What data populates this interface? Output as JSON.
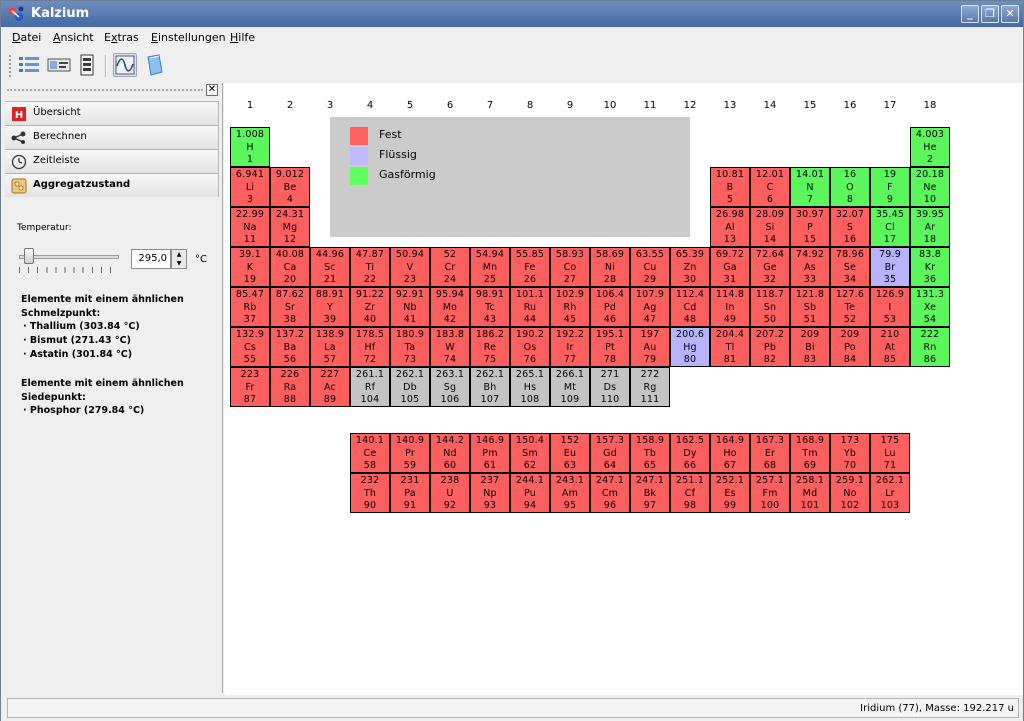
{
  "window": {
    "title": "Kalzium"
  },
  "menu": [
    "Datei",
    "Ansicht",
    "Extras",
    "Einstellungen",
    "Hilfe"
  ],
  "menu_underline": [
    "D",
    "A",
    "x",
    "E",
    "H"
  ],
  "sidebar": {
    "tabs": [
      "Übersicht",
      "Berechnen",
      "Zeitleiste",
      "Aggregatzustand"
    ],
    "temperature_label": "Temperatur:",
    "temperature_value": "295,0",
    "temperature_unit": "°C",
    "slider_level_fraction": 0.05,
    "melting_heading": "Elemente mit einem ähnlichen Schmelzpunkt:",
    "melting": [
      "· Thallium (303.84 °C)",
      "· Bismut (271.43 °C)",
      "· Astatin (301.84 °C)"
    ],
    "boiling_heading": "Elemente mit einem ähnlichen Siedepunkt:",
    "boiling": [
      "· Phosphor (279.84 °C)"
    ]
  },
  "groups": [
    "1",
    "2",
    "3",
    "4",
    "5",
    "6",
    "7",
    "8",
    "9",
    "10",
    "11",
    "12",
    "13",
    "14",
    "15",
    "16",
    "17",
    "18"
  ],
  "legend": [
    {
      "label": "Fest",
      "color": "#ff6060"
    },
    {
      "label": "Flüssig",
      "color": "#bfb8ff"
    },
    {
      "label": "Gasförmig",
      "color": "#60ff60"
    }
  ],
  "state_colors": {
    "s": "#ff5f5f",
    "l": "#b9b2ff",
    "g": "#5cf75c",
    "u": "#c4c4c4"
  },
  "elements": [
    [
      "1.008",
      "H",
      "1",
      1,
      1,
      "g"
    ],
    [
      "4.003",
      "He",
      "2",
      18,
      1,
      "g"
    ],
    [
      "6.941",
      "Li",
      "3",
      1,
      2,
      "s"
    ],
    [
      "9.012",
      "Be",
      "4",
      2,
      2,
      "s"
    ],
    [
      "10.81",
      "B",
      "5",
      13,
      2,
      "s"
    ],
    [
      "12.01",
      "C",
      "6",
      14,
      2,
      "s"
    ],
    [
      "14.01",
      "N",
      "7",
      15,
      2,
      "g"
    ],
    [
      "16",
      "O",
      "8",
      16,
      2,
      "g"
    ],
    [
      "19",
      "F",
      "9",
      17,
      2,
      "g"
    ],
    [
      "20.18",
      "Ne",
      "10",
      18,
      2,
      "g"
    ],
    [
      "22.99",
      "Na",
      "11",
      1,
      3,
      "s"
    ],
    [
      "24.31",
      "Mg",
      "12",
      2,
      3,
      "s"
    ],
    [
      "26.98",
      "Al",
      "13",
      13,
      3,
      "s"
    ],
    [
      "28.09",
      "Si",
      "14",
      14,
      3,
      "s"
    ],
    [
      "30.97",
      "P",
      "15",
      15,
      3,
      "s"
    ],
    [
      "32.07",
      "S",
      "16",
      16,
      3,
      "s"
    ],
    [
      "35.45",
      "Cl",
      "17",
      17,
      3,
      "g"
    ],
    [
      "39.95",
      "Ar",
      "18",
      18,
      3,
      "g"
    ],
    [
      "39.1",
      "K",
      "19",
      1,
      4,
      "s"
    ],
    [
      "40.08",
      "Ca",
      "20",
      2,
      4,
      "s"
    ],
    [
      "44.96",
      "Sc",
      "21",
      3,
      4,
      "s"
    ],
    [
      "47.87",
      "Ti",
      "22",
      4,
      4,
      "s"
    ],
    [
      "50.94",
      "V",
      "23",
      5,
      4,
      "s"
    ],
    [
      "52",
      "Cr",
      "24",
      6,
      4,
      "s"
    ],
    [
      "54.94",
      "Mn",
      "25",
      7,
      4,
      "s"
    ],
    [
      "55.85",
      "Fe",
      "26",
      8,
      4,
      "s"
    ],
    [
      "58.93",
      "Co",
      "27",
      9,
      4,
      "s"
    ],
    [
      "58.69",
      "Ni",
      "28",
      10,
      4,
      "s"
    ],
    [
      "63.55",
      "Cu",
      "29",
      11,
      4,
      "s"
    ],
    [
      "65.39",
      "Zn",
      "30",
      12,
      4,
      "s"
    ],
    [
      "69.72",
      "Ga",
      "31",
      13,
      4,
      "s"
    ],
    [
      "72.64",
      "Ge",
      "32",
      14,
      4,
      "s"
    ],
    [
      "74.92",
      "As",
      "33",
      15,
      4,
      "s"
    ],
    [
      "78.96",
      "Se",
      "34",
      16,
      4,
      "s"
    ],
    [
      "79.9",
      "Br",
      "35",
      17,
      4,
      "l"
    ],
    [
      "83.8",
      "Kr",
      "36",
      18,
      4,
      "g"
    ],
    [
      "85.47",
      "Rb",
      "37",
      1,
      5,
      "s"
    ],
    [
      "87.62",
      "Sr",
      "38",
      2,
      5,
      "s"
    ],
    [
      "88.91",
      "Y",
      "39",
      3,
      5,
      "s"
    ],
    [
      "91.22",
      "Zr",
      "40",
      4,
      5,
      "s"
    ],
    [
      "92.91",
      "Nb",
      "41",
      5,
      5,
      "s"
    ],
    [
      "95.94",
      "Mo",
      "42",
      6,
      5,
      "s"
    ],
    [
      "98.91",
      "Tc",
      "43",
      7,
      5,
      "s"
    ],
    [
      "101.1",
      "Ru",
      "44",
      8,
      5,
      "s"
    ],
    [
      "102.9",
      "Rh",
      "45",
      9,
      5,
      "s"
    ],
    [
      "106.4",
      "Pd",
      "46",
      10,
      5,
      "s"
    ],
    [
      "107.9",
      "Ag",
      "47",
      11,
      5,
      "s"
    ],
    [
      "112.4",
      "Cd",
      "48",
      12,
      5,
      "s"
    ],
    [
      "114.8",
      "In",
      "49",
      13,
      5,
      "s"
    ],
    [
      "118.7",
      "Sn",
      "50",
      14,
      5,
      "s"
    ],
    [
      "121.8",
      "Sb",
      "51",
      15,
      5,
      "s"
    ],
    [
      "127.6",
      "Te",
      "52",
      16,
      5,
      "s"
    ],
    [
      "126.9",
      "I",
      "53",
      17,
      5,
      "s"
    ],
    [
      "131.3",
      "Xe",
      "54",
      18,
      5,
      "g"
    ],
    [
      "132.9",
      "Cs",
      "55",
      1,
      6,
      "s"
    ],
    [
      "137.2",
      "Ba",
      "56",
      2,
      6,
      "s"
    ],
    [
      "138.9",
      "La",
      "57",
      3,
      6,
      "s"
    ],
    [
      "178.5",
      "Hf",
      "72",
      4,
      6,
      "s"
    ],
    [
      "180.9",
      "Ta",
      "73",
      5,
      6,
      "s"
    ],
    [
      "183.8",
      "W",
      "74",
      6,
      6,
      "s"
    ],
    [
      "186.2",
      "Re",
      "75",
      7,
      6,
      "s"
    ],
    [
      "190.2",
      "Os",
      "76",
      8,
      6,
      "s"
    ],
    [
      "192.2",
      "Ir",
      "77",
      9,
      6,
      "s"
    ],
    [
      "195.1",
      "Pt",
      "78",
      10,
      6,
      "s"
    ],
    [
      "197",
      "Au",
      "79",
      11,
      6,
      "s"
    ],
    [
      "200.6",
      "Hg",
      "80",
      12,
      6,
      "l"
    ],
    [
      "204.4",
      "Tl",
      "81",
      13,
      6,
      "s"
    ],
    [
      "207.2",
      "Pb",
      "82",
      14,
      6,
      "s"
    ],
    [
      "209",
      "Bi",
      "83",
      15,
      6,
      "s"
    ],
    [
      "209",
      "Po",
      "84",
      16,
      6,
      "s"
    ],
    [
      "210",
      "At",
      "85",
      17,
      6,
      "s"
    ],
    [
      "222",
      "Rn",
      "86",
      18,
      6,
      "g"
    ],
    [
      "223",
      "Fr",
      "87",
      1,
      7,
      "s"
    ],
    [
      "226",
      "Ra",
      "88",
      2,
      7,
      "s"
    ],
    [
      "227",
      "Ac",
      "89",
      3,
      7,
      "s"
    ],
    [
      "261.1",
      "Rf",
      "104",
      4,
      7,
      "u"
    ],
    [
      "262.1",
      "Db",
      "105",
      5,
      7,
      "u"
    ],
    [
      "263.1",
      "Sg",
      "106",
      6,
      7,
      "u"
    ],
    [
      "262.1",
      "Bh",
      "107",
      7,
      7,
      "u"
    ],
    [
      "265.1",
      "Hs",
      "108",
      8,
      7,
      "u"
    ],
    [
      "266.1",
      "Mt",
      "109",
      9,
      7,
      "u"
    ],
    [
      "271",
      "Ds",
      "110",
      10,
      7,
      "u"
    ],
    [
      "272",
      "Rg",
      "111",
      11,
      7,
      "u"
    ],
    [
      "140.1",
      "Ce",
      "58",
      4,
      9,
      "s"
    ],
    [
      "140.9",
      "Pr",
      "59",
      5,
      9,
      "s"
    ],
    [
      "144.2",
      "Nd",
      "60",
      6,
      9,
      "s"
    ],
    [
      "146.9",
      "Pm",
      "61",
      7,
      9,
      "s"
    ],
    [
      "150.4",
      "Sm",
      "62",
      8,
      9,
      "s"
    ],
    [
      "152",
      "Eu",
      "63",
      9,
      9,
      "s"
    ],
    [
      "157.3",
      "Gd",
      "64",
      10,
      9,
      "s"
    ],
    [
      "158.9",
      "Tb",
      "65",
      11,
      9,
      "s"
    ],
    [
      "162.5",
      "Dy",
      "66",
      12,
      9,
      "s"
    ],
    [
      "164.9",
      "Ho",
      "67",
      13,
      9,
      "s"
    ],
    [
      "167.3",
      "Er",
      "68",
      14,
      9,
      "s"
    ],
    [
      "168.9",
      "Tm",
      "69",
      15,
      9,
      "s"
    ],
    [
      "173",
      "Yb",
      "70",
      16,
      9,
      "s"
    ],
    [
      "175",
      "Lu",
      "71",
      17,
      9,
      "s"
    ],
    [
      "232",
      "Th",
      "90",
      4,
      10,
      "s"
    ],
    [
      "231",
      "Pa",
      "91",
      5,
      10,
      "s"
    ],
    [
      "238",
      "U",
      "92",
      6,
      10,
      "s"
    ],
    [
      "237",
      "Np",
      "93",
      7,
      10,
      "s"
    ],
    [
      "244.1",
      "Pu",
      "94",
      8,
      10,
      "s"
    ],
    [
      "243.1",
      "Am",
      "95",
      9,
      10,
      "s"
    ],
    [
      "247.1",
      "Cm",
      "96",
      10,
      10,
      "s"
    ],
    [
      "247.1",
      "Bk",
      "97",
      11,
      10,
      "s"
    ],
    [
      "251.1",
      "Cf",
      "98",
      12,
      10,
      "s"
    ],
    [
      "252.1",
      "Es",
      "99",
      13,
      10,
      "s"
    ],
    [
      "257.1",
      "Fm",
      "100",
      14,
      10,
      "s"
    ],
    [
      "258.1",
      "Md",
      "101",
      15,
      10,
      "s"
    ],
    [
      "259.1",
      "No",
      "102",
      16,
      10,
      "s"
    ],
    [
      "262.1",
      "Lr",
      "103",
      17,
      10,
      "s"
    ]
  ],
  "status": "Iridium (77), Masse: 192.217 u"
}
